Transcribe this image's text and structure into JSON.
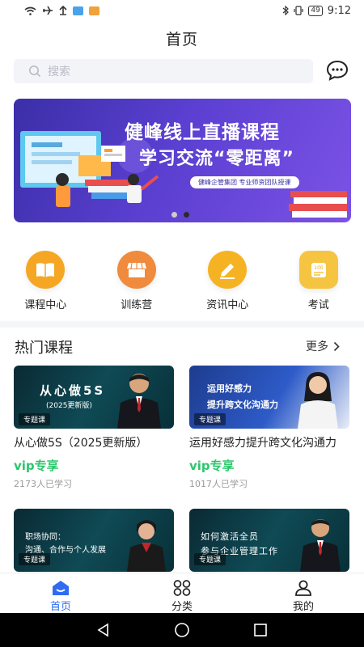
{
  "status_bar": {
    "battery": "49",
    "time": "9:12"
  },
  "header": {
    "title": "首页"
  },
  "search": {
    "placeholder": "搜索"
  },
  "banner": {
    "title": "健峰线上直播课程",
    "subtitle": "学习交流“零距离”",
    "pill": "健峰企管集团 专业师资团队授课"
  },
  "categories": [
    {
      "label": "课程中心",
      "icon": "book-icon",
      "color": "#f5a623"
    },
    {
      "label": "训练营",
      "icon": "store-icon",
      "color": "#f08a3c"
    },
    {
      "label": "资讯中心",
      "icon": "edit-icon",
      "color": "#f5b323"
    },
    {
      "label": "考试",
      "icon": "exam-icon",
      "color": "#f5c542"
    }
  ],
  "hot_courses": {
    "title": "热门课程",
    "more": "更多",
    "items": [
      {
        "thumb_text": "从心做5S",
        "thumb_sub": "(2025更新版)",
        "tag": "专题课",
        "title": "从心做5S（2025更新版）",
        "vip": "vip专享",
        "learners": "2173人已学习"
      },
      {
        "thumb_text": "运用好感力",
        "thumb_sub": "提升跨文化沟通力",
        "tag": "专题课",
        "title": "运用好感力提升跨文化沟通力",
        "vip": "vip专享",
        "learners": "1017人已学习"
      },
      {
        "thumb_text": "职场协同：",
        "thumb_sub": "沟通、合作与个人发展",
        "tag": "专题课"
      },
      {
        "thumb_text": "如何激活全员",
        "thumb_sub": "参与企业管理工作",
        "tag": "专题课"
      }
    ]
  },
  "bottom_nav": [
    {
      "label": "首页",
      "icon": "home-icon",
      "active": true
    },
    {
      "label": "分类",
      "icon": "grid-icon",
      "active": false
    },
    {
      "label": "我的",
      "icon": "user-icon",
      "active": false
    }
  ],
  "colors": {
    "accent": "#2f6cf0",
    "vip": "#2cc66d"
  }
}
